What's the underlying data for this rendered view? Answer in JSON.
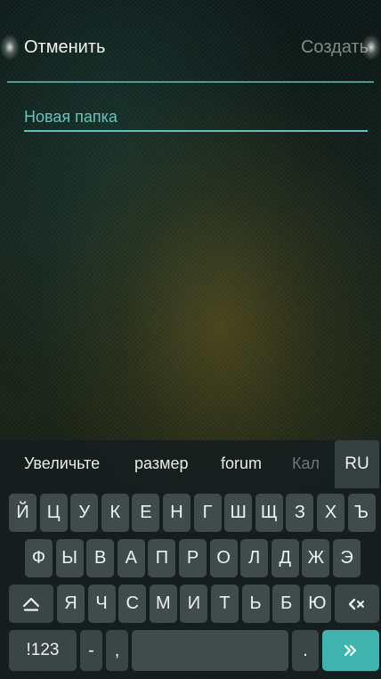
{
  "header": {
    "cancel_label": "Отменить",
    "create_label": "Создать"
  },
  "folder_name": {
    "placeholder": "Новая папка",
    "value": ""
  },
  "keyboard": {
    "suggestions": [
      "Увеличьте",
      "размер",
      "forum",
      "Кал"
    ],
    "language": "RU",
    "rows": [
      [
        "Й",
        "Ц",
        "У",
        "К",
        "Е",
        "Н",
        "Г",
        "Ш",
        "Щ",
        "З",
        "Х",
        "Ъ"
      ],
      [
        "Ф",
        "Ы",
        "В",
        "А",
        "П",
        "Р",
        "О",
        "Л",
        "Д",
        "Ж",
        "Э"
      ],
      [
        "Я",
        "Ч",
        "С",
        "М",
        "И",
        "Т",
        "Ь",
        "Б",
        "Ю"
      ]
    ],
    "symbols_label": "!123",
    "dash_label": "-",
    "comma_label": ",",
    "period_label": ".",
    "shift_icon": "shift-arrow-icon",
    "backspace_icon": "backspace-icon",
    "enter_icon": "double-chevron-right-icon",
    "accent": "#3fb3ad"
  }
}
